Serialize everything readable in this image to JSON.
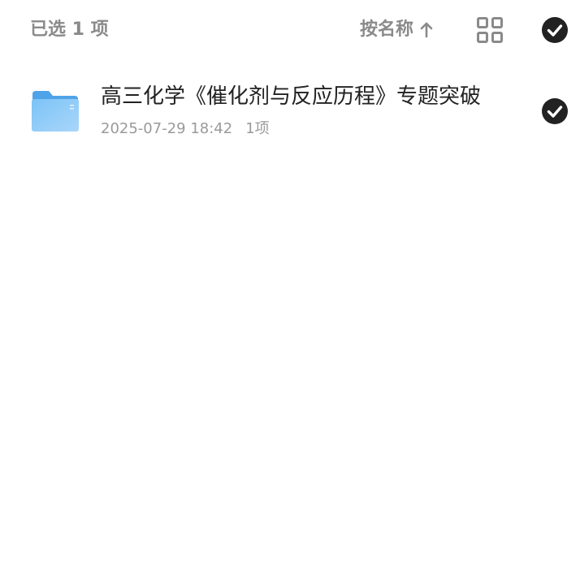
{
  "header": {
    "selection_count": "已选 1 项",
    "sort_label": "按名称",
    "sort_direction": "ascending",
    "grid_icon": "grid-view-icon",
    "select_all_icon": "check-circle-icon",
    "select_all_checked": true
  },
  "files": [
    {
      "type": "folder",
      "icon": "folder-icon",
      "name": "高三化学《催化剂与反应历程》专题突破",
      "modified": "2025-07-29 18:42",
      "item_count": "1项",
      "selected": true
    }
  ],
  "colors": {
    "muted_text": "#8a8a8a",
    "primary_text": "#222222",
    "meta_text": "#9a9a9a",
    "check_fill": "#222222",
    "folder_blue": "#5aaef0"
  }
}
